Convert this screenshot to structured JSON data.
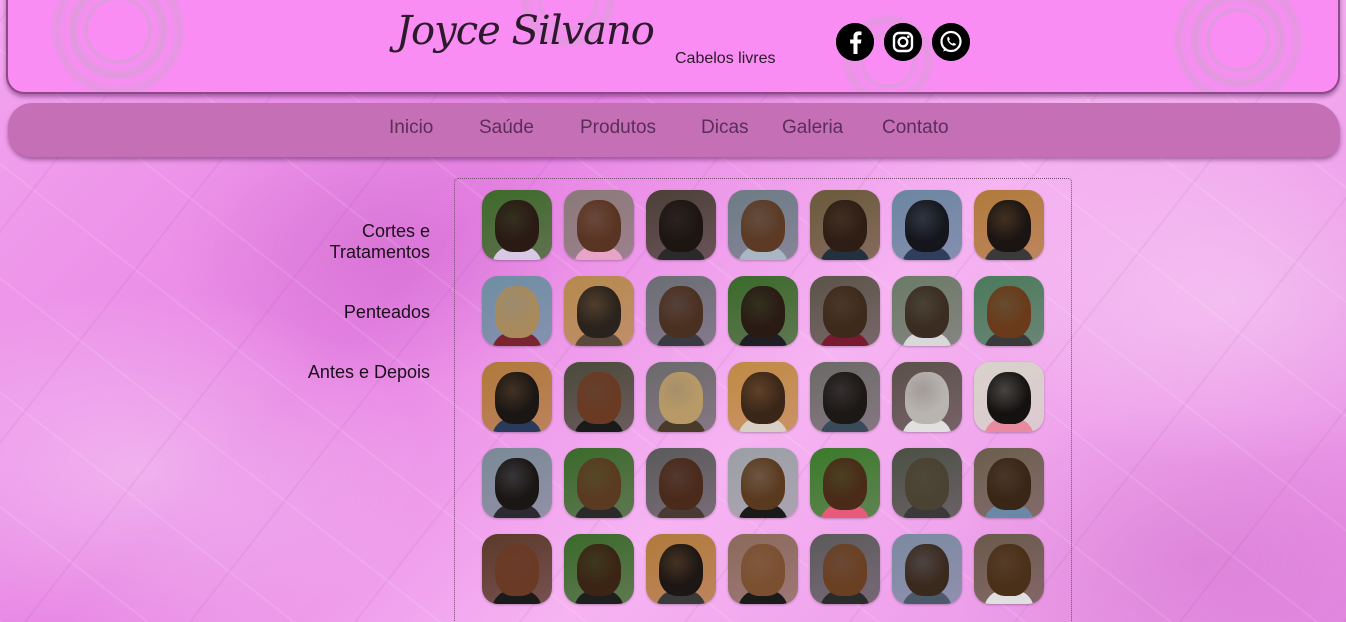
{
  "header": {
    "brand": "Joyce Silvano",
    "tagline": "Cabelos livres",
    "social": [
      {
        "icon": "facebook-icon",
        "glyph": "f"
      },
      {
        "icon": "instagram-icon",
        "glyph": ""
      },
      {
        "icon": "whatsapp-icon",
        "glyph": ""
      }
    ]
  },
  "nav": {
    "items": [
      "Inicio",
      "Saúde",
      "Produtos",
      "Dicas",
      "Galeria",
      "Contato"
    ]
  },
  "sidebar": {
    "categories": [
      {
        "line1": "Cortes e",
        "line2": "Tratamentos"
      },
      {
        "line1": "Penteados",
        "line2": ""
      },
      {
        "line1": "Antes e Depois",
        "line2": ""
      }
    ]
  },
  "colors": {
    "header_bg": "#f98df4",
    "nav_bg": "#c56fb6",
    "nav_text": "#5a2f56",
    "gallery_border": "#7a4a74"
  },
  "gallery": {
    "photos": [
      {
        "bg": "#3e6b2a",
        "hair": "#2a1a14",
        "shirt": "#d9c7e6"
      },
      {
        "bg": "#8a7a78",
        "hair": "#5a3422",
        "shirt": "#e7a4c6"
      },
      {
        "bg": "#4a4036",
        "hair": "#1c1512",
        "shirt": "#2a2a2a"
      },
      {
        "bg": "#6c7c84",
        "hair": "#5c3a24",
        "shirt": "#a9b7c4"
      },
      {
        "bg": "#6a5a3a",
        "hair": "#2e1d14",
        "shirt": "#23303e"
      },
      {
        "bg": "#6a86a0",
        "hair": "#15161c",
        "shirt": "#2e3e5c"
      },
      {
        "bg": "#b07a3a",
        "hair": "#1a1412",
        "shirt": "#3a3a3a"
      },
      {
        "bg": "#6e8fa2",
        "hair": "#a88a5c",
        "shirt": "#7a2430"
      },
      {
        "bg": "#b58a4c",
        "hair": "#2a221c",
        "shirt": "#5a4a3c"
      },
      {
        "bg": "#6a6e74",
        "hair": "#4a3020",
        "shirt": "#3a3a44"
      },
      {
        "bg": "#3a6a2a",
        "hair": "#2a1a14",
        "shirt": "#1e1e24"
      },
      {
        "bg": "#5a5448",
        "hair": "#3e2a1a",
        "shirt": "#7a1a30"
      },
      {
        "bg": "#6a7a66",
        "hair": "#3a2c20",
        "shirt": "#d8d8d8"
      },
      {
        "bg": "#4a7a5a",
        "hair": "#6a3a1a",
        "shirt": "#3a3a3a"
      },
      {
        "bg": "#b07a3a",
        "hair": "#1a1614",
        "shirt": "#2a3a5a"
      },
      {
        "bg": "#4a4a3a",
        "hair": "#6a3a22",
        "shirt": "#1a1a1a"
      },
      {
        "bg": "#6a6a6a",
        "hair": "#b89a66",
        "shirt": "#4a3a2a"
      },
      {
        "bg": "#c08a44",
        "hair": "#3a2618",
        "shirt": "#d8d0c4"
      },
      {
        "bg": "#6a6a66",
        "hair": "#1c1816",
        "shirt": "#3a4a5a"
      },
      {
        "bg": "#5a5048",
        "hair": "#b8b4b0",
        "shirt": "#e0e0e0"
      },
      {
        "bg": "#d8d2ca",
        "hair": "#141210",
        "shirt": "#e88aa0"
      },
      {
        "bg": "#7a8a96",
        "hair": "#1a1614",
        "shirt": "#2a2a30"
      },
      {
        "bg": "#3a6a2a",
        "hair": "#5a3a20",
        "shirt": "#2a2a2a"
      },
      {
        "bg": "#5a5a5a",
        "hair": "#4a2a1a",
        "shirt": "#4a3a34"
      },
      {
        "bg": "#9aa0a4",
        "hair": "#5a3a1e",
        "shirt": "#1a1a1a"
      },
      {
        "bg": "#3a7a2a",
        "hair": "#4a2a18",
        "shirt": "#e85a7a"
      },
      {
        "bg": "#4a5044",
        "hair": "#4a4232",
        "shirt": "#3a3a3a"
      },
      {
        "bg": "#6a5e4c",
        "hair": "#3a2616",
        "shirt": "#6a88a8"
      },
      {
        "bg": "#5a3a2a",
        "hair": "#6a3a24",
        "shirt": "#1a1a1a"
      },
      {
        "bg": "#3a6a2a",
        "hair": "#3a2414",
        "shirt": "#1e1e1e"
      },
      {
        "bg": "#b07a3a",
        "hair": "#1c1614",
        "shirt": "#3a3a3a"
      },
      {
        "bg": "#8a6a5a",
        "hair": "#7a5030",
        "shirt": "#1a1a1a"
      },
      {
        "bg": "#5a5a5a",
        "hair": "#6a4022",
        "shirt": "#2a2a2a"
      },
      {
        "bg": "#7a8aa0",
        "hair": "#3a2a1e",
        "shirt": "#4a5a6a"
      },
      {
        "bg": "#6a5a4a",
        "hair": "#4a3018",
        "shirt": "#e0e0e0"
      }
    ]
  }
}
